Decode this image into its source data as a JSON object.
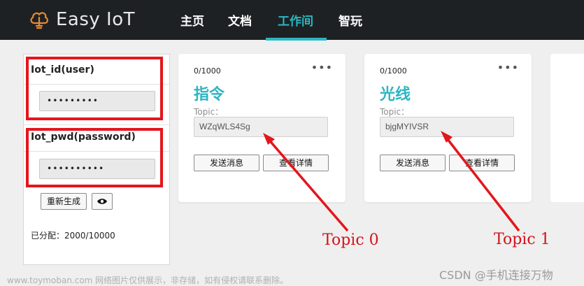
{
  "header": {
    "logo_text": "Easy IoT",
    "logo_icon": "cloud-lightbulb-icon",
    "nav": [
      {
        "label": "主页",
        "active": false
      },
      {
        "label": "文档",
        "active": false
      },
      {
        "label": "工作间",
        "active": true
      },
      {
        "label": "智玩",
        "active": false
      }
    ],
    "accent_color": "#29b8c2"
  },
  "credentials": {
    "iot_id_label": "Iot_id(user)",
    "iot_id_value": "•••••••••",
    "iot_pwd_label": "Iot_pwd(password)",
    "iot_pwd_value": "••••••••••",
    "regenerate_label": "重新生成",
    "eye_icon": "eye-icon",
    "quota_text": "已分配：2000/10000"
  },
  "cards": [
    {
      "count": "0/1000",
      "title": "指令",
      "topic_label": "Topic：",
      "topic_value": "WZqWLS4Sg",
      "send_label": "发送消息",
      "details_label": "查看详情"
    },
    {
      "count": "0/1000",
      "title": "光线",
      "topic_label": "Topic：",
      "topic_value": "bjgMYIVSR",
      "send_label": "发送消息",
      "details_label": "查看详情"
    }
  ],
  "annotations": {
    "topic0": "Topic 0",
    "topic1": "Topic 1",
    "color": "#e3161c"
  },
  "watermark": "www.toymoban.com 网络图片仅供展示，非存储，如有侵权请联系删除。",
  "csdn_mark": "CSDN @手机连接万物"
}
